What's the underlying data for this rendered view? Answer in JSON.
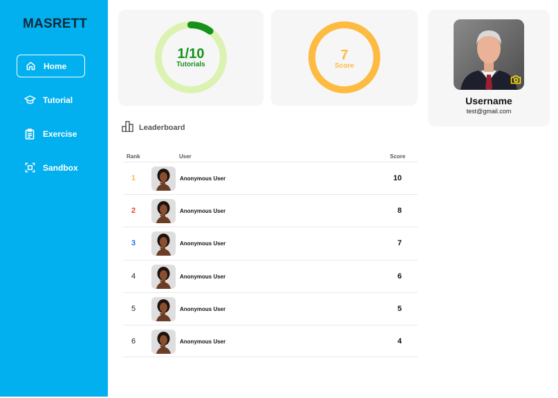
{
  "brand": "MASRETT",
  "nav": [
    {
      "label": "Home",
      "icon": "home-icon",
      "active": true
    },
    {
      "label": "Tutorial",
      "icon": "graduation-cap-icon",
      "active": false
    },
    {
      "label": "Exercise",
      "icon": "clipboard-icon",
      "active": false
    },
    {
      "label": "Sandbox",
      "icon": "sandbox-frame-icon",
      "active": false
    }
  ],
  "stats": {
    "tutorials": {
      "value": "1/10",
      "label": "Tutorials",
      "progress_fraction": 0.1,
      "color": "#16921a",
      "track_color": "#dcf2b1"
    },
    "score": {
      "value": "7",
      "label": "Score",
      "color": "#fdbb42"
    }
  },
  "profile": {
    "username": "Username",
    "email": "test@gmail.com",
    "camera_icon": "camera-icon",
    "camera_color": "#ffe000"
  },
  "leaderboard": {
    "title": "Leaderboard",
    "columns": {
      "rank": "Rank",
      "user": "User",
      "score": "Score"
    },
    "rows": [
      {
        "rank": "1",
        "user": "Anonymous User",
        "score": "10",
        "rank_color": "#fdbb42"
      },
      {
        "rank": "2",
        "user": "Anonymous User",
        "score": "8",
        "rank_color": "#ee3b2d"
      },
      {
        "rank": "3",
        "user": "Anonymous User",
        "score": "7",
        "rank_color": "#2d6df0"
      },
      {
        "rank": "4",
        "user": "Anonymous User",
        "score": "6",
        "rank_color": "#222222"
      },
      {
        "rank": "5",
        "user": "Anonymous User",
        "score": "5",
        "rank_color": "#222222"
      },
      {
        "rank": "6",
        "user": "Anonymous User",
        "score": "4",
        "rank_color": "#222222"
      }
    ]
  }
}
